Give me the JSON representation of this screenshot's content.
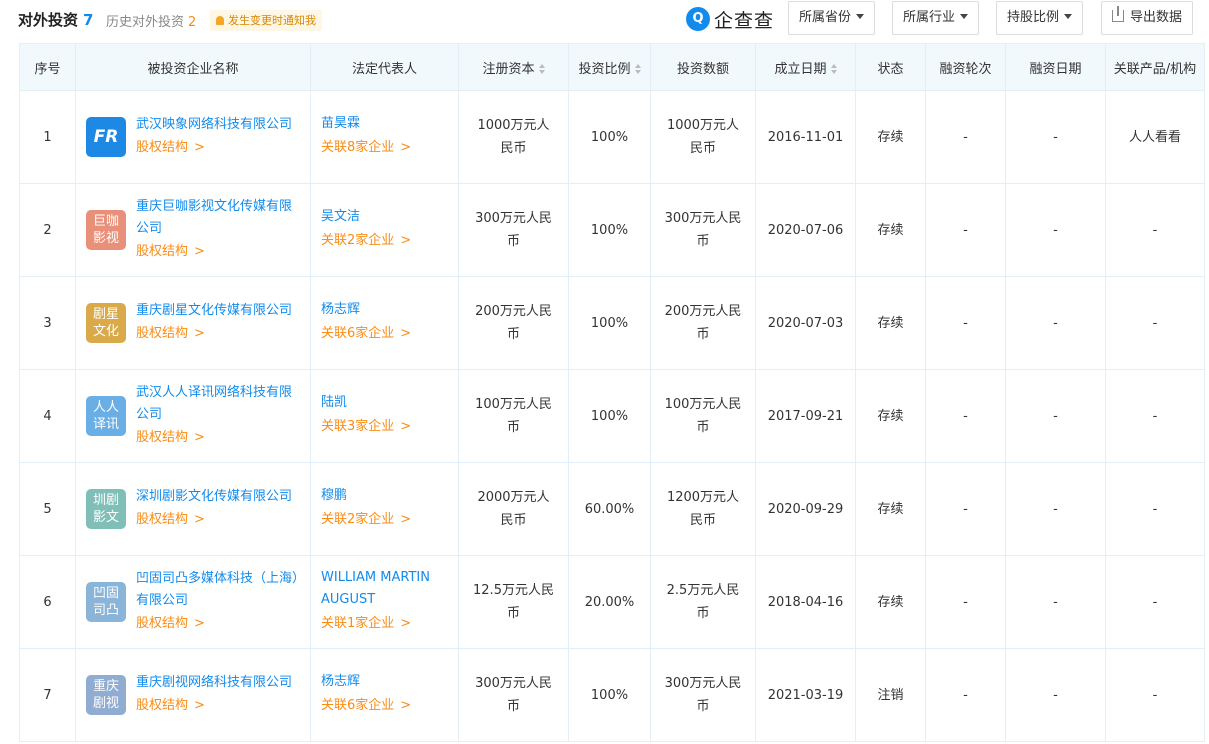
{
  "header": {
    "title": "对外投资",
    "title_count": "7",
    "history_label": "历史对外投资",
    "history_count": "2",
    "notify_label": "发生变更时通知我",
    "logo_mark": "Q",
    "logo_text": "企查查",
    "filters": [
      {
        "label": "所属省份"
      },
      {
        "label": "所属行业"
      },
      {
        "label": "持股比例"
      }
    ],
    "export_label": "导出数据"
  },
  "table": {
    "columns": [
      "序号",
      "被投资企业名称",
      "法定代表人",
      "注册资本",
      "投资比例",
      "投资数额",
      "成立日期",
      "状态",
      "融资轮次",
      "融资日期",
      "关联产品/机构"
    ],
    "equity_label": "股权结构",
    "rows": [
      {
        "no": "1",
        "name": "武汉映象网络科技有限公司",
        "logo_text": "FR",
        "logo_color": "#1e88e5",
        "rep": "苗昊霖",
        "rep_rel": "关联8家企业",
        "capital": "1000万元人民币",
        "ratio": "100%",
        "amount": "1000万元人民币",
        "date": "2016-11-01",
        "status": "存续",
        "round": "-",
        "fund_date": "-",
        "product": "人人看看"
      },
      {
        "no": "2",
        "name": "重庆巨咖影视文化传媒有限公司",
        "logo_text": "巨咖影视",
        "logo_color": "#e8907a",
        "rep": "吴文洁",
        "rep_rel": "关联2家企业",
        "capital": "300万元人民币",
        "ratio": "100%",
        "amount": "300万元人民币",
        "date": "2020-07-06",
        "status": "存续",
        "round": "-",
        "fund_date": "-",
        "product": "-"
      },
      {
        "no": "3",
        "name": "重庆剧星文化传媒有限公司",
        "logo_text": "剧星文化",
        "logo_color": "#d9a94a",
        "rep": "杨志辉",
        "rep_rel": "关联6家企业",
        "capital": "200万元人民币",
        "ratio": "100%",
        "amount": "200万元人民币",
        "date": "2020-07-03",
        "status": "存续",
        "round": "-",
        "fund_date": "-",
        "product": "-"
      },
      {
        "no": "4",
        "name": "武汉人人译讯网络科技有限公司",
        "logo_text": "人人译讯",
        "logo_color": "#6aaee6",
        "rep": "陆凯",
        "rep_rel": "关联3家企业",
        "capital": "100万元人民币",
        "ratio": "100%",
        "amount": "100万元人民币",
        "date": "2017-09-21",
        "status": "存续",
        "round": "-",
        "fund_date": "-",
        "product": "-"
      },
      {
        "no": "5",
        "name": "深圳剧影文化传媒有限公司",
        "logo_text": "圳剧影文",
        "logo_color": "#7fbfb8",
        "rep": "穆鹏",
        "rep_rel": "关联2家企业",
        "capital": "2000万元人民币",
        "ratio": "60.00%",
        "amount": "1200万元人民币",
        "date": "2020-09-29",
        "status": "存续",
        "round": "-",
        "fund_date": "-",
        "product": "-"
      },
      {
        "no": "6",
        "name": "凹固司凸多媒体科技（上海）有限公司",
        "logo_text": "凹固司凸",
        "logo_color": "#8ab4d8",
        "rep": "WILLIAM MARTIN AUGUST",
        "rep_rel": "关联1家企业",
        "capital": "12.5万元人民币",
        "ratio": "20.00%",
        "amount": "2.5万元人民币",
        "date": "2018-04-16",
        "status": "存续",
        "round": "-",
        "fund_date": "-",
        "product": "-"
      },
      {
        "no": "7",
        "name": "重庆剧视网络科技有限公司",
        "logo_text": "重庆剧视",
        "logo_color": "#90acd0",
        "rep": "杨志辉",
        "rep_rel": "关联6家企业",
        "capital": "300万元人民币",
        "ratio": "100%",
        "amount": "300万元人民币",
        "date": "2021-03-19",
        "status": "注销",
        "round": "-",
        "fund_date": "-",
        "product": "-"
      }
    ]
  }
}
